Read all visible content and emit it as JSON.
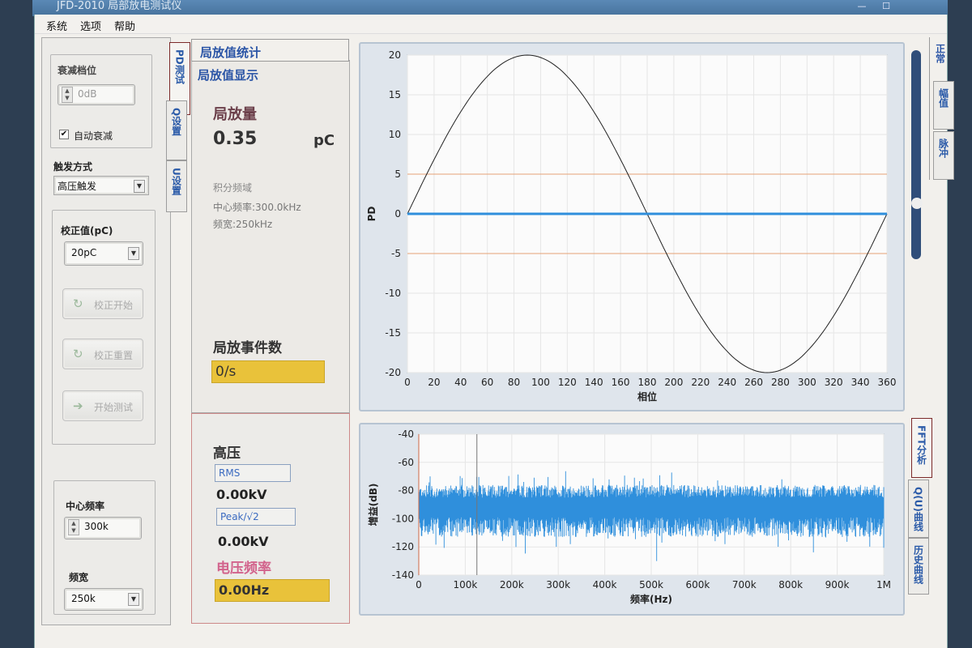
{
  "window": {
    "title": "JFD-2010 局部放电测试仪"
  },
  "menu": [
    "系统",
    "选项",
    "帮助"
  ],
  "left": {
    "attenuation": {
      "group_label": "衰减档位",
      "value": "0dB",
      "auto_label": "自动衰减",
      "auto_checked": true
    },
    "trigger": {
      "label": "触发方式",
      "value": "高压触发"
    },
    "calibration": {
      "label": "校正值(pC)",
      "value": "20pC",
      "start_label": "校正开始",
      "reset_label": "校正重置",
      "test_label": "开始测试"
    },
    "filter": {
      "center_label": "中心频率",
      "center_value": "300k",
      "bw_label": "频宽",
      "bw_value": "250k"
    }
  },
  "vtabs": [
    "PD测试",
    "Q设置",
    "U设置"
  ],
  "stats": {
    "tab1": "局放值统计",
    "tab2": "局放值显示",
    "pd_label": "局放量",
    "pd_value": "0.35",
    "pd_unit": "pC",
    "band_title": "积分频域",
    "center_freq": "中心频率:300.0kHz",
    "bandwidth": "频宽:250kHz",
    "events_label": "局放事件数",
    "events_value": "0/s"
  },
  "hv": {
    "title": "高压",
    "rms_label": "RMS",
    "rms_value": "0.00kV",
    "peak_label": "Peak/√2",
    "peak_value": "0.00kV",
    "freq_label": "电压频率",
    "freq_value": "0.00Hz"
  },
  "right_tabs_top": [
    "正常",
    "幅值",
    "脉冲"
  ],
  "right_tabs_bottom": [
    "FFT分析",
    "Q(U)曲线",
    "历史曲线"
  ],
  "colors": {
    "tab_blue": "#2b55a6",
    "signal_blue": "#2f8fdc",
    "threshold_orange": "#e6a274",
    "event_yellow": "#e9c23a",
    "hv_freq_pink": "#d2638c"
  },
  "chart_data": [
    {
      "type": "line",
      "ylabel": "PD",
      "xlabel": "相位",
      "xlim": [
        0,
        360
      ],
      "ylim": [
        -20,
        20
      ],
      "xticks": [
        0,
        20,
        40,
        60,
        80,
        100,
        120,
        140,
        160,
        180,
        200,
        220,
        240,
        260,
        280,
        300,
        320,
        340,
        360
      ],
      "yticks": [
        20,
        15,
        10,
        5,
        0,
        -5,
        -10,
        -15,
        -20
      ],
      "series": [
        {
          "kind": "sine",
          "amplitude": 20,
          "color": "#222222"
        },
        {
          "kind": "flat",
          "value": 0,
          "color": "#2f8fdc"
        }
      ],
      "thresholds": [
        5,
        -5
      ]
    },
    {
      "type": "line",
      "ylabel": "增益(dB)",
      "xlabel": "频率(Hz)",
      "xlim": [
        0,
        1000000
      ],
      "ylim": [
        -140,
        -40
      ],
      "xticks": [
        "0",
        "100k",
        "200k",
        "300k",
        "400k",
        "500k",
        "600k",
        "700k",
        "800k",
        "900k",
        "1M"
      ],
      "yticks": [
        -40,
        -60,
        -80,
        -100,
        -120,
        -140
      ],
      "noise_band": {
        "center": -92,
        "spread": 10
      },
      "markers_x": [
        0,
        125000
      ]
    }
  ]
}
